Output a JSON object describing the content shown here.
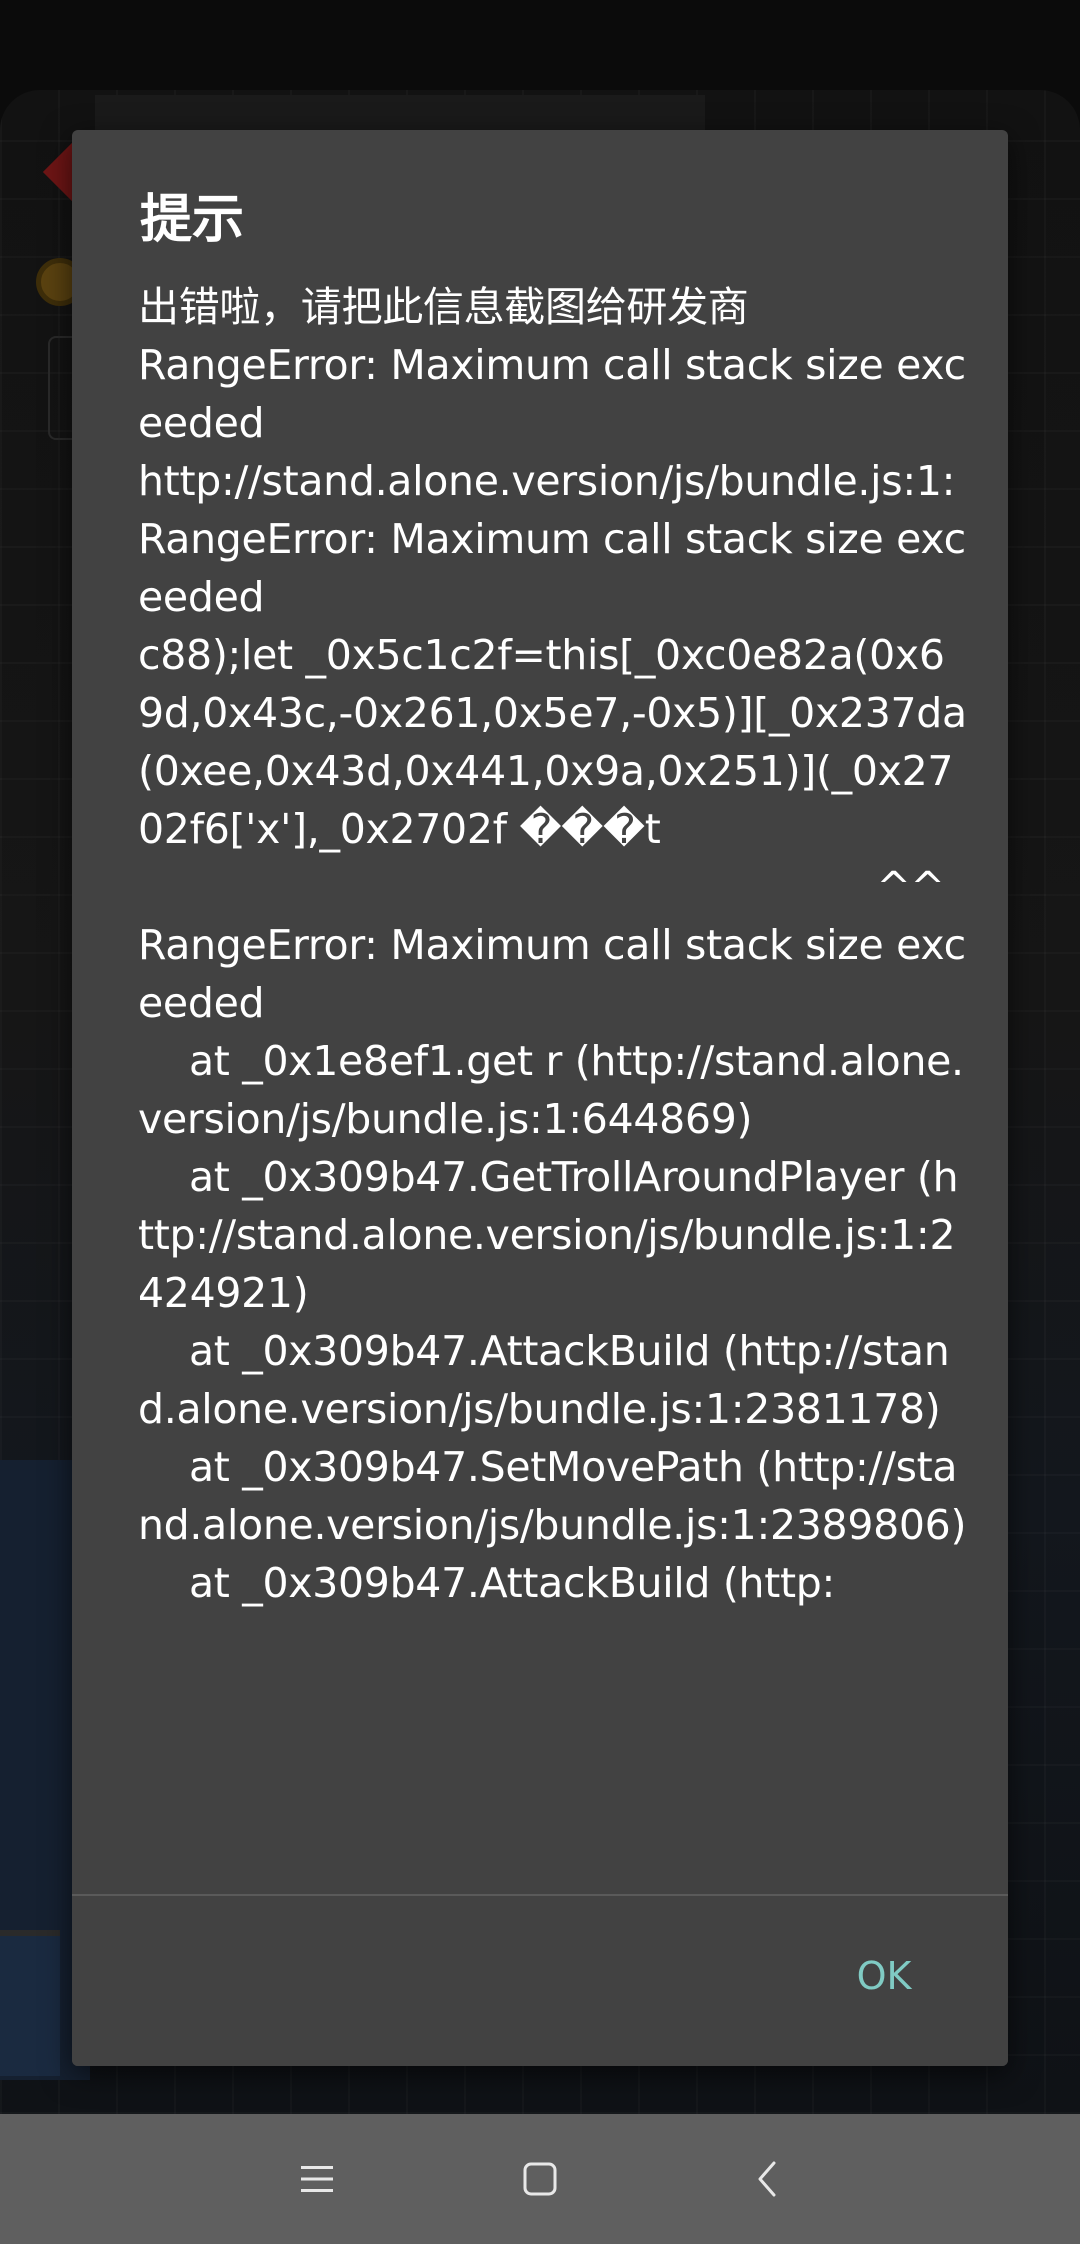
{
  "dialog": {
    "title": "提示",
    "message": "出错啦，请把此信息截图给研发商\nRangeError: Maximum call stack size exceeded\nhttp://stand.alone.version/js/bundle.js:1:\nRangeError: Maximum call stack size exceeded\nc88);let _0x5c1c2f=this[_0xc0e82a(0x69d,0x43c,-0x261,0x5e7,-0x5)][_0x237da(0xee,0x43d,0x441,0x9a,0x251)](_0x2702f6['x'],_0x2702f ���t\n                                                          ^^\nRangeError: Maximum call stack size exceeded\n    at _0x1e8ef1.get r (http://stand.alone.version/js/bundle.js:1:644869)\n    at _0x309b47.GetTrollAroundPlayer (http://stand.alone.version/js/bundle.js:1:2424921)\n    at _0x309b47.AttackBuild (http://stand.alone.version/js/bundle.js:1:2381178)\n    at _0x309b47.SetMovePath (http://stand.alone.version/js/bundle.js:1:2389806)\n    at _0x309b47.AttackBuild (http:",
    "ok_label": "OK"
  },
  "nav_bar": {
    "icons": [
      "menu-icon",
      "home-square-icon",
      "back-chevron-icon"
    ]
  },
  "colors": {
    "dialog_background": "#424242",
    "text": "#ffffff",
    "accent": "#80cbc4",
    "nav_bar": "#5f5f5f"
  }
}
